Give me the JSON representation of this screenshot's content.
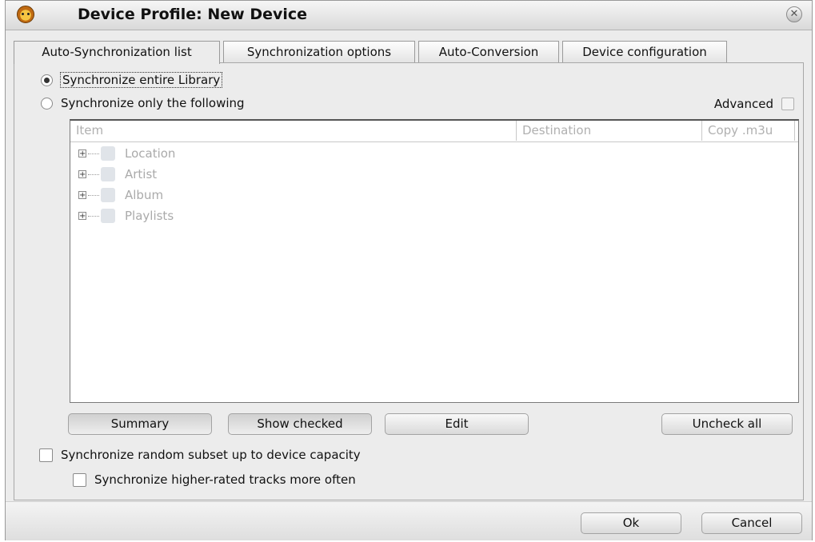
{
  "window": {
    "title": "Device Profile: New Device"
  },
  "tabs": [
    {
      "label": "Auto-Synchronization list"
    },
    {
      "label": "Synchronization options"
    },
    {
      "label": "Auto-Conversion"
    },
    {
      "label": "Device configuration"
    }
  ],
  "sync": {
    "entire_library": "Synchronize entire Library",
    "only_following": "Synchronize only the following",
    "advanced": "Advanced"
  },
  "tree": {
    "columns": [
      "Item",
      "Destination",
      "Copy .m3u"
    ],
    "items": [
      {
        "label": "Location"
      },
      {
        "label": "Artist"
      },
      {
        "label": "Album"
      },
      {
        "label": "Playlists"
      }
    ]
  },
  "buttons": {
    "summary": "Summary",
    "show_checked": "Show checked",
    "edit": "Edit",
    "uncheck_all": "Uncheck all",
    "ok": "Ok",
    "cancel": "Cancel"
  },
  "options": {
    "random_subset": "Synchronize random subset up to device capacity",
    "higher_rated": "Synchronize higher-rated tracks more often"
  }
}
